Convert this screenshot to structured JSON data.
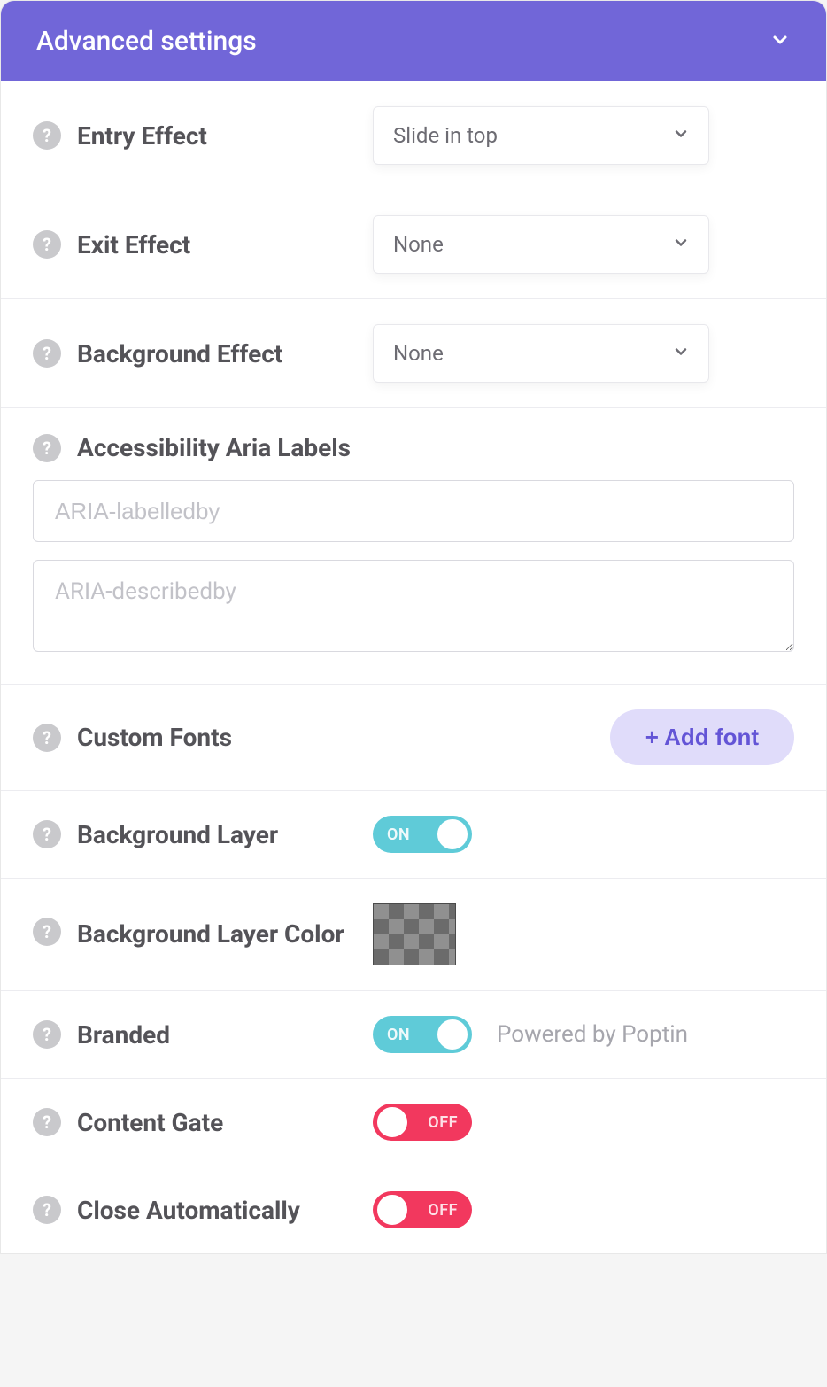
{
  "header": {
    "title": "Advanced settings"
  },
  "entryEffect": {
    "label": "Entry Effect",
    "value": "Slide in top"
  },
  "exitEffect": {
    "label": "Exit Effect",
    "value": "None"
  },
  "backgroundEffect": {
    "label": "Background Effect",
    "value": "None"
  },
  "accessibility": {
    "label": "Accessibility Aria Labels",
    "labelledbyPlaceholder": "ARIA-labelledby",
    "describedbyPlaceholder": "ARIA-describedby"
  },
  "customFonts": {
    "label": "Custom Fonts",
    "addButton": "+ Add font"
  },
  "backgroundLayer": {
    "label": "Background Layer",
    "state": "ON"
  },
  "backgroundLayerColor": {
    "label": "Background Layer Color"
  },
  "branded": {
    "label": "Branded",
    "state": "ON",
    "note": "Powered by Poptin"
  },
  "contentGate": {
    "label": "Content Gate",
    "state": "OFF"
  },
  "closeAutomatically": {
    "label": "Close Automatically",
    "state": "OFF"
  },
  "toggleLabels": {
    "on": "ON",
    "off": "OFF"
  }
}
